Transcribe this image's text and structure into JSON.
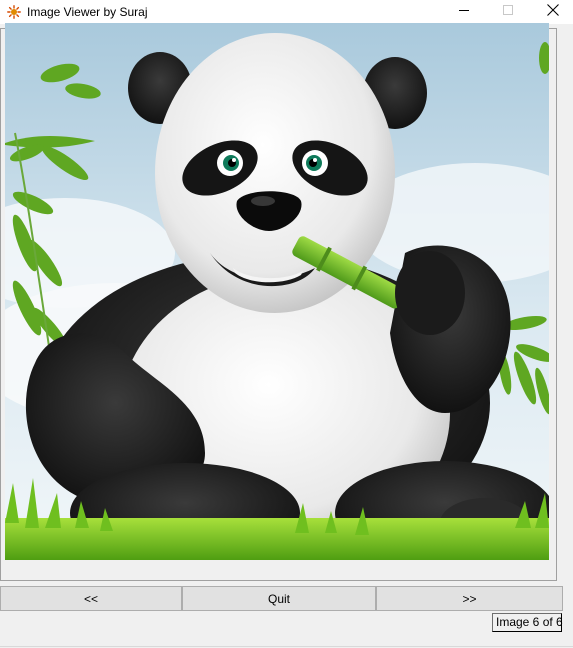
{
  "window": {
    "title": "Image Viewer by Suraj",
    "icons": {
      "app": "feather-tk-icon",
      "minimize": "minimize-icon",
      "maximize": "maximize-icon",
      "close": "close-icon"
    }
  },
  "viewer": {
    "image": "panda-eating-bamboo-image"
  },
  "controls": {
    "prev_label": "<<",
    "quit_label": "Quit",
    "next_label": ">>"
  },
  "status": {
    "text": "Image 6 of 6"
  }
}
